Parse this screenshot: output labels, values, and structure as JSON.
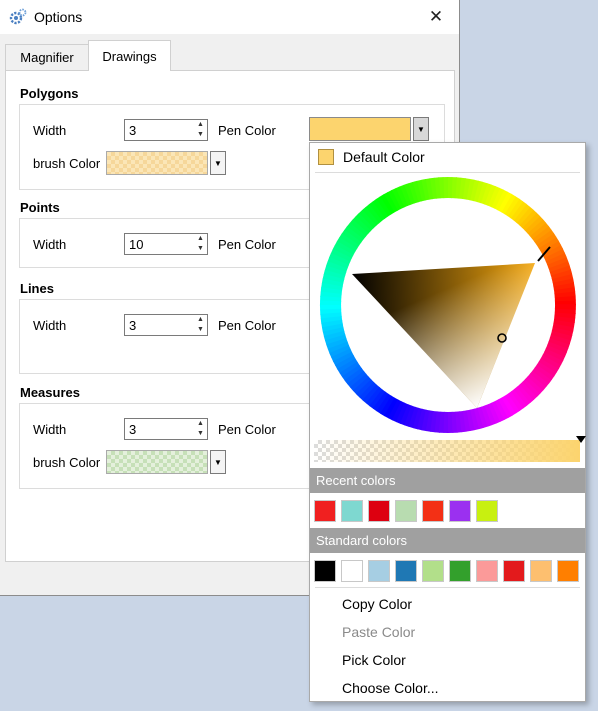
{
  "window": {
    "title": "Options",
    "close_glyph": "✕"
  },
  "tabs": [
    {
      "label": "Magnifier"
    },
    {
      "label": "Drawings"
    }
  ],
  "polygons": {
    "title": "Polygons",
    "width_label": "Width",
    "width_value": "3",
    "pen_label": "Pen Color",
    "pen_color": "#fcd46e",
    "brush_label": "brush Color",
    "brush_color": "#f6d79a"
  },
  "points": {
    "title": "Points",
    "width_label": "Width",
    "width_value": "10",
    "pen_label": "Pen Color"
  },
  "lines": {
    "title": "Lines",
    "width_label": "Width",
    "width_value": "3",
    "pen_label": "Pen Color"
  },
  "measures": {
    "title": "Measures",
    "width_label": "Width",
    "width_value": "3",
    "pen_label": "Pen Color",
    "brush_label": "brush Color",
    "brush_color": "#c6e0b8"
  },
  "color_popup": {
    "default_label": "Default Color",
    "default_color": "#fcd46e",
    "recent_header": "Recent colors",
    "recent_colors": [
      "#f02020",
      "#7ed8d0",
      "#dd0010",
      "#b8dcb0",
      "#f33015",
      "#9b30f0",
      "#c8f010"
    ],
    "standard_header": "Standard colors",
    "standard_colors": [
      "#000000",
      "#ffffff",
      "#a6cee3",
      "#1f78b4",
      "#b2df8a",
      "#33a02c",
      "#fb9a99",
      "#e31a1c",
      "#fdbf6f",
      "#ff7f00"
    ],
    "menu": {
      "copy": "Copy Color",
      "paste": "Paste Color",
      "pick": "Pick Color",
      "choose": "Choose Color..."
    }
  },
  "icons": {
    "app": "gear-icon",
    "close": "close-icon",
    "spin": "spin-arrows-icon",
    "dropdown": "chevron-down-icon"
  }
}
